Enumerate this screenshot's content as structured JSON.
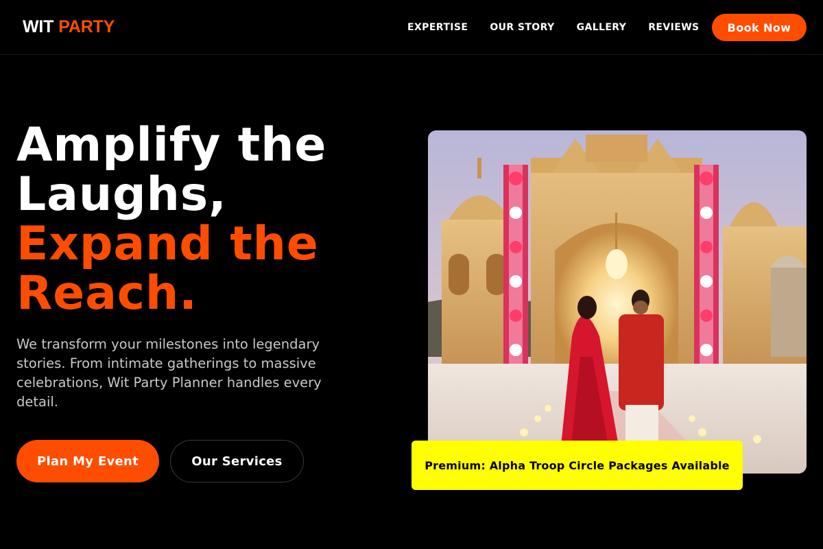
{
  "brand": {
    "part1": "WIT",
    "part2": "PARTY"
  },
  "nav": {
    "links": [
      "EXPERTISE",
      "OUR STORY",
      "GALLERY",
      "REVIEWS"
    ],
    "cta": "Book Now"
  },
  "hero": {
    "line1": "Amplify the",
    "line2": "Laughs,",
    "line3": "Expand the",
    "line4": "Reach.",
    "subtext": "We transform your milestones into legendary stories. From intimate gatherings to massive celebrations, Wit Party Planner handles every detail.",
    "primary_button": "Plan My Event",
    "secondary_button": "Our Services"
  },
  "photo": {
    "subject": "wedding-couple-floral-mandap"
  },
  "promo": {
    "text": "Premium: Alpha Troop Circle Packages Available"
  },
  "colors": {
    "accent": "#ff4d00",
    "highlight": "#ffff00",
    "background": "#000000"
  }
}
